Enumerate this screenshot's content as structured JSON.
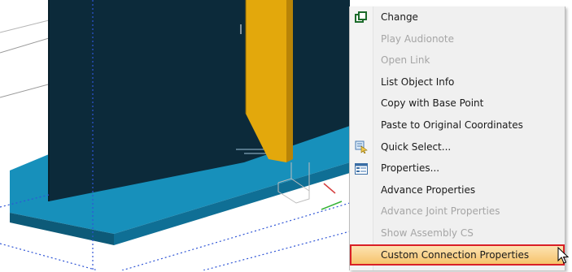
{
  "context_menu": {
    "items": [
      {
        "label": "Change",
        "enabled": true,
        "icon": "change-icon"
      },
      {
        "label": "Play Audionote",
        "enabled": false,
        "icon": ""
      },
      {
        "label": "Open Link",
        "enabled": false,
        "icon": ""
      },
      {
        "label": "List Object Info",
        "enabled": true,
        "icon": ""
      },
      {
        "label": "Copy with Base Point",
        "enabled": true,
        "icon": ""
      },
      {
        "label": "Paste to Original Coordinates",
        "enabled": true,
        "icon": ""
      },
      {
        "label": "Quick Select...",
        "enabled": true,
        "icon": "quick-select-icon"
      },
      {
        "label": "Properties...",
        "enabled": true,
        "icon": "properties-icon"
      },
      {
        "label": "Advance Properties",
        "enabled": true,
        "icon": ""
      },
      {
        "label": "Advance Joint Properties",
        "enabled": false,
        "icon": ""
      },
      {
        "label": "Show Assembly CS",
        "enabled": false,
        "icon": ""
      },
      {
        "label": "Custom Connection Properties",
        "enabled": true,
        "icon": "",
        "highlighted": true
      }
    ]
  },
  "colors": {
    "beam_dark": "#0c2a3a",
    "beam_blue": "#1790bb",
    "stiffener": "#e3a80c",
    "highlight_border": "#d91f26"
  }
}
